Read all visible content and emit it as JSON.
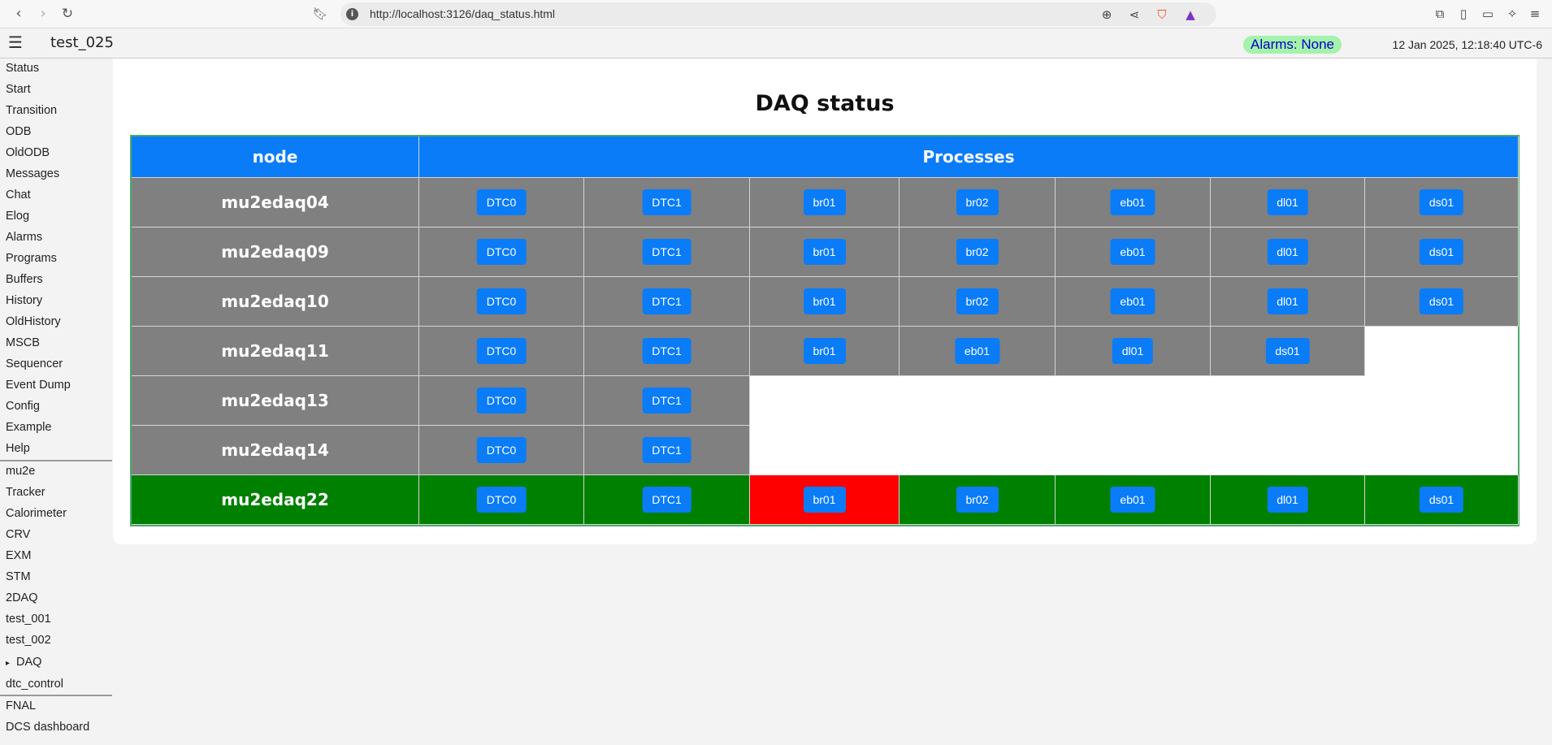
{
  "browser": {
    "url": "http://localhost:3126/daq_status.html"
  },
  "header": {
    "experiment": "test_025",
    "alarms": "Alarms: None",
    "clock": "12 Jan 2025, 12:18:40 UTC-6"
  },
  "sidebar": {
    "items": [
      "Status",
      "Start",
      "Transition",
      "ODB",
      "OldODB",
      "Messages",
      "Chat",
      "Elog",
      "Alarms",
      "Programs",
      "Buffers",
      "History",
      "OldHistory",
      "MSCB",
      "Sequencer",
      "Event Dump",
      "Config",
      "Example",
      "Help"
    ],
    "custom": [
      "mu2e",
      "Tracker",
      "Calorimeter",
      "CRV",
      "EXM",
      "STM",
      "2DAQ",
      "test_001",
      "test_002"
    ],
    "daq_group": "DAQ",
    "dtc_control": "dtc_control",
    "links": [
      "FNAL",
      "DCS dashboard"
    ]
  },
  "page": {
    "title": "DAQ status"
  },
  "table": {
    "headers": {
      "node": "node",
      "processes": "Processes"
    },
    "rows": [
      {
        "node": "mu2edaq04",
        "status": "gray",
        "processes": [
          "DTC0",
          "DTC1",
          "br01",
          "br02",
          "eb01",
          "dl01",
          "ds01"
        ],
        "states": [
          "ok",
          "ok",
          "ok",
          "ok",
          "ok",
          "ok",
          "ok"
        ]
      },
      {
        "node": "mu2edaq09",
        "status": "gray",
        "processes": [
          "DTC0",
          "DTC1",
          "br01",
          "br02",
          "eb01",
          "dl01",
          "ds01"
        ],
        "states": [
          "ok",
          "ok",
          "ok",
          "ok",
          "ok",
          "ok",
          "ok"
        ]
      },
      {
        "node": "mu2edaq10",
        "status": "gray",
        "processes": [
          "DTC0",
          "DTC1",
          "br01",
          "br02",
          "eb01",
          "dl01",
          "ds01"
        ],
        "states": [
          "ok",
          "ok",
          "ok",
          "ok",
          "ok",
          "ok",
          "ok"
        ]
      },
      {
        "node": "mu2edaq11",
        "status": "gray",
        "processes": [
          "DTC0",
          "DTC1",
          "br01",
          "eb01",
          "dl01",
          "ds01"
        ],
        "states": [
          "ok",
          "ok",
          "ok",
          "ok",
          "ok",
          "ok"
        ]
      },
      {
        "node": "mu2edaq13",
        "status": "gray",
        "processes": [
          "DTC0",
          "DTC1"
        ],
        "states": [
          "ok",
          "ok"
        ]
      },
      {
        "node": "mu2edaq14",
        "status": "gray",
        "processes": [
          "DTC0",
          "DTC1"
        ],
        "states": [
          "ok",
          "ok"
        ]
      },
      {
        "node": "mu2edaq22",
        "status": "green",
        "processes": [
          "DTC0",
          "DTC1",
          "br01",
          "br02",
          "eb01",
          "dl01",
          "ds01"
        ],
        "states": [
          "ok",
          "ok",
          "error",
          "ok",
          "ok",
          "ok",
          "ok"
        ]
      }
    ]
  },
  "colors": {
    "header_blue": "#0a7cf8",
    "node_gray": "#808080",
    "node_green": "#008000",
    "error_red": "#ff0000",
    "alarm_bg": "#a5f2ab"
  }
}
